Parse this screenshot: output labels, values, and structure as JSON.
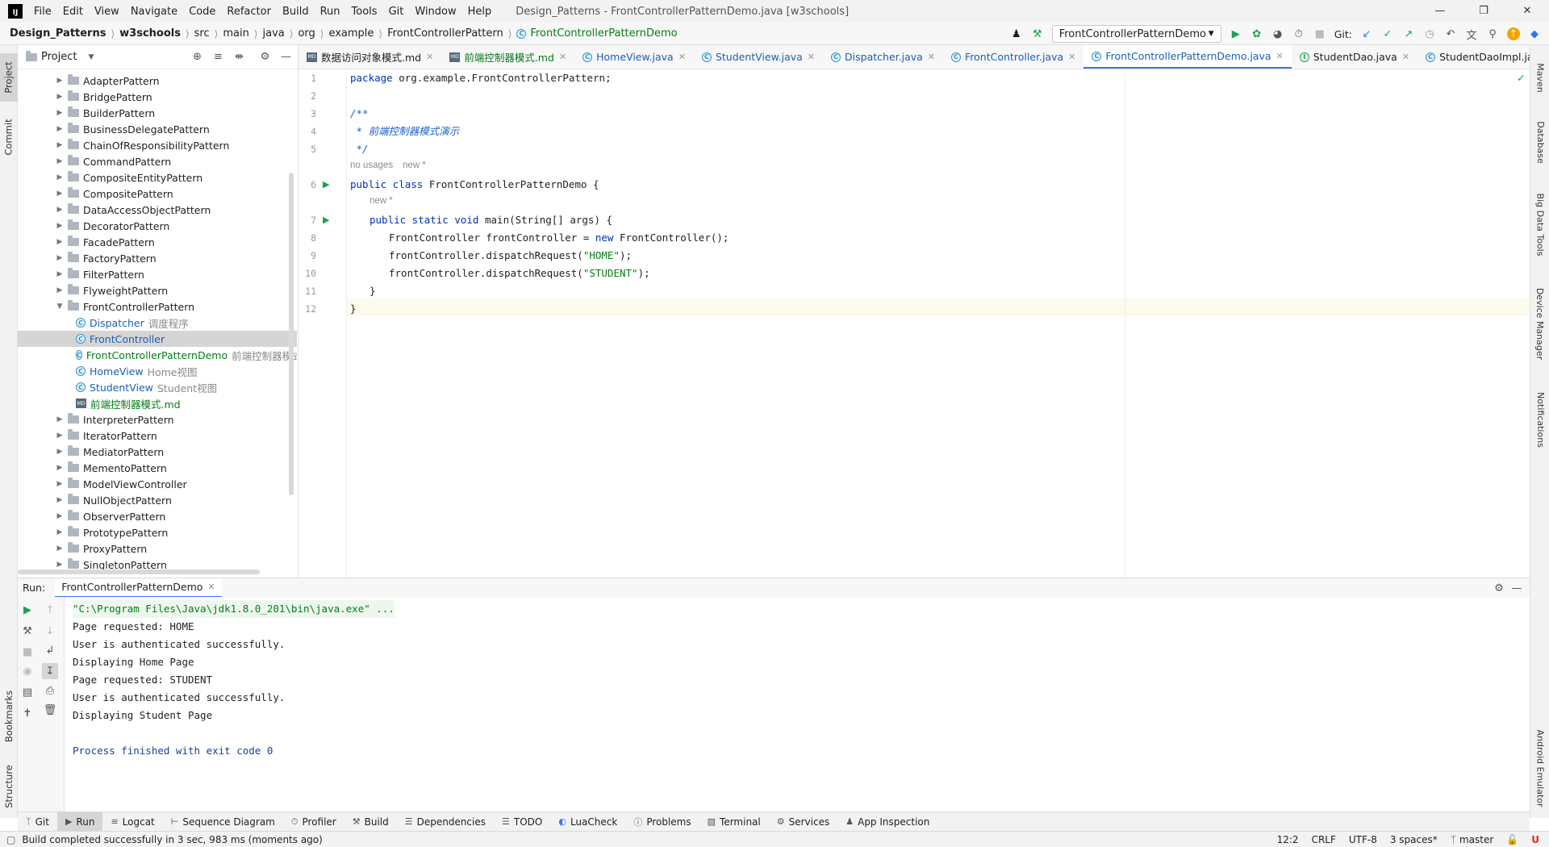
{
  "window": {
    "menu": [
      "File",
      "Edit",
      "View",
      "Navigate",
      "Code",
      "Refactor",
      "Build",
      "Run",
      "Tools",
      "Git",
      "Window",
      "Help"
    ],
    "title": "Design_Patterns - FrontControllerPatternDemo.java [w3schools]"
  },
  "breadcrumb": [
    "Design_Patterns",
    "w3schools",
    "src",
    "main",
    "java",
    "org",
    "example",
    "FrontControllerPattern",
    "FrontControllerPatternDemo"
  ],
  "run_config": "FrontControllerPatternDemo",
  "git_label": "Git:",
  "left_tabs": [
    "Project",
    "Commit",
    "Bookmarks",
    "Structure"
  ],
  "right_tabs": [
    "Maven",
    "Database",
    "Big Data Tools",
    "Device Manager",
    "Notifications",
    "Android Emulator"
  ],
  "project": {
    "header": "Project",
    "items": [
      {
        "label": "AdapterPattern",
        "type": "folder"
      },
      {
        "label": "BridgePattern",
        "type": "folder"
      },
      {
        "label": "BuilderPattern",
        "type": "folder"
      },
      {
        "label": "BusinessDelegatePattern",
        "type": "folder"
      },
      {
        "label": "ChainOfResponsibilityPattern",
        "type": "folder"
      },
      {
        "label": "CommandPattern",
        "type": "folder"
      },
      {
        "label": "CompositeEntityPattern",
        "type": "folder"
      },
      {
        "label": "CompositePattern",
        "type": "folder"
      },
      {
        "label": "DataAccessObjectPattern",
        "type": "folder"
      },
      {
        "label": "DecoratorPattern",
        "type": "folder"
      },
      {
        "label": "FacadePattern",
        "type": "folder"
      },
      {
        "label": "FactoryPattern",
        "type": "folder"
      },
      {
        "label": "FilterPattern",
        "type": "folder"
      },
      {
        "label": "FlyweightPattern",
        "type": "folder"
      },
      {
        "label": "FrontControllerPattern",
        "type": "folder-open"
      },
      {
        "label": "Dispatcher",
        "note": "调度程序",
        "type": "class"
      },
      {
        "label": "FrontController",
        "note": "",
        "type": "class-selected"
      },
      {
        "label": "FrontControllerPatternDemo",
        "note": "前端控制器模式演",
        "type": "class-main"
      },
      {
        "label": "HomeView",
        "note": "Home视图",
        "type": "class"
      },
      {
        "label": "StudentView",
        "note": "Student视图",
        "type": "class"
      },
      {
        "label": "前端控制器模式.md",
        "note": "",
        "type": "md"
      },
      {
        "label": "InterpreterPattern",
        "type": "folder"
      },
      {
        "label": "IteratorPattern",
        "type": "folder"
      },
      {
        "label": "MediatorPattern",
        "type": "folder"
      },
      {
        "label": "MementoPattern",
        "type": "folder"
      },
      {
        "label": "ModelViewController",
        "type": "folder"
      },
      {
        "label": "NullObjectPattern",
        "type": "folder"
      },
      {
        "label": "ObserverPattern",
        "type": "folder"
      },
      {
        "label": "PrototypePattern",
        "type": "folder"
      },
      {
        "label": "ProxyPattern",
        "type": "folder"
      },
      {
        "label": "SingletonPattern",
        "type": "folder"
      }
    ]
  },
  "tabs": [
    {
      "label": "数据访问对象模式.md",
      "kind": "md"
    },
    {
      "label": "前端控制器模式.md",
      "kind": "md-green"
    },
    {
      "label": "HomeView.java",
      "kind": "class"
    },
    {
      "label": "StudentView.java",
      "kind": "class"
    },
    {
      "label": "Dispatcher.java",
      "kind": "class"
    },
    {
      "label": "FrontController.java",
      "kind": "class"
    },
    {
      "label": "FrontControllerPatternDemo.java",
      "kind": "active"
    },
    {
      "label": "StudentDao.java",
      "kind": "iface"
    },
    {
      "label": "StudentDaoImpl.java",
      "kind": "class"
    }
  ],
  "editor": {
    "line_numbers": [
      "1",
      "2",
      "3",
      "4",
      "5",
      "6",
      "7",
      "8",
      "9",
      "10",
      "11",
      "12"
    ],
    "hint_usages": "no usages",
    "hint_new": "new *",
    "code": {
      "l1_kw": "package",
      "l1_rest": " org.example.FrontControllerPattern;",
      "l3": "/**",
      "l4": " * 前端控制器模式演示",
      "l5": " */",
      "l6_kw": "public class",
      "l6_rest": " FrontControllerPatternDemo {",
      "l7_kw": "public static void",
      "l7_rest": " main(String[] args) {",
      "l8_a": "FrontController frontController = ",
      "l8_kw": "new",
      "l8_b": " FrontController();",
      "l9_a": "frontController.dispatchRequest(",
      "l9_str": "\"HOME\"",
      "l9_b": ");",
      "l10_a": "frontController.dispatchRequest(",
      "l10_str": "\"STUDENT\"",
      "l10_b": ");",
      "l11": "}",
      "l12": "}"
    }
  },
  "run": {
    "label": "Run:",
    "tab": "FrontControllerPatternDemo",
    "output": [
      "\"C:\\Program Files\\Java\\jdk1.8.0_201\\bin\\java.exe\" ...",
      "Page requested: HOME",
      "User is authenticated successfully.",
      "Displaying Home Page",
      "Page requested: STUDENT",
      "User is authenticated successfully.",
      "Displaying Student Page",
      "",
      "Process finished with exit code 0"
    ]
  },
  "bottom_tools": [
    "Git",
    "Run",
    "Logcat",
    "Sequence Diagram",
    "Profiler",
    "Build",
    "Dependencies",
    "TODO",
    "LuaCheck",
    "Problems",
    "Terminal",
    "Services",
    "App Inspection"
  ],
  "status": {
    "message": "Build completed successfully in 3 sec, 983 ms (moments ago)",
    "position": "12:2",
    "line_sep": "CRLF",
    "encoding": "UTF-8",
    "indent": "3 spaces*",
    "branch": "master"
  }
}
